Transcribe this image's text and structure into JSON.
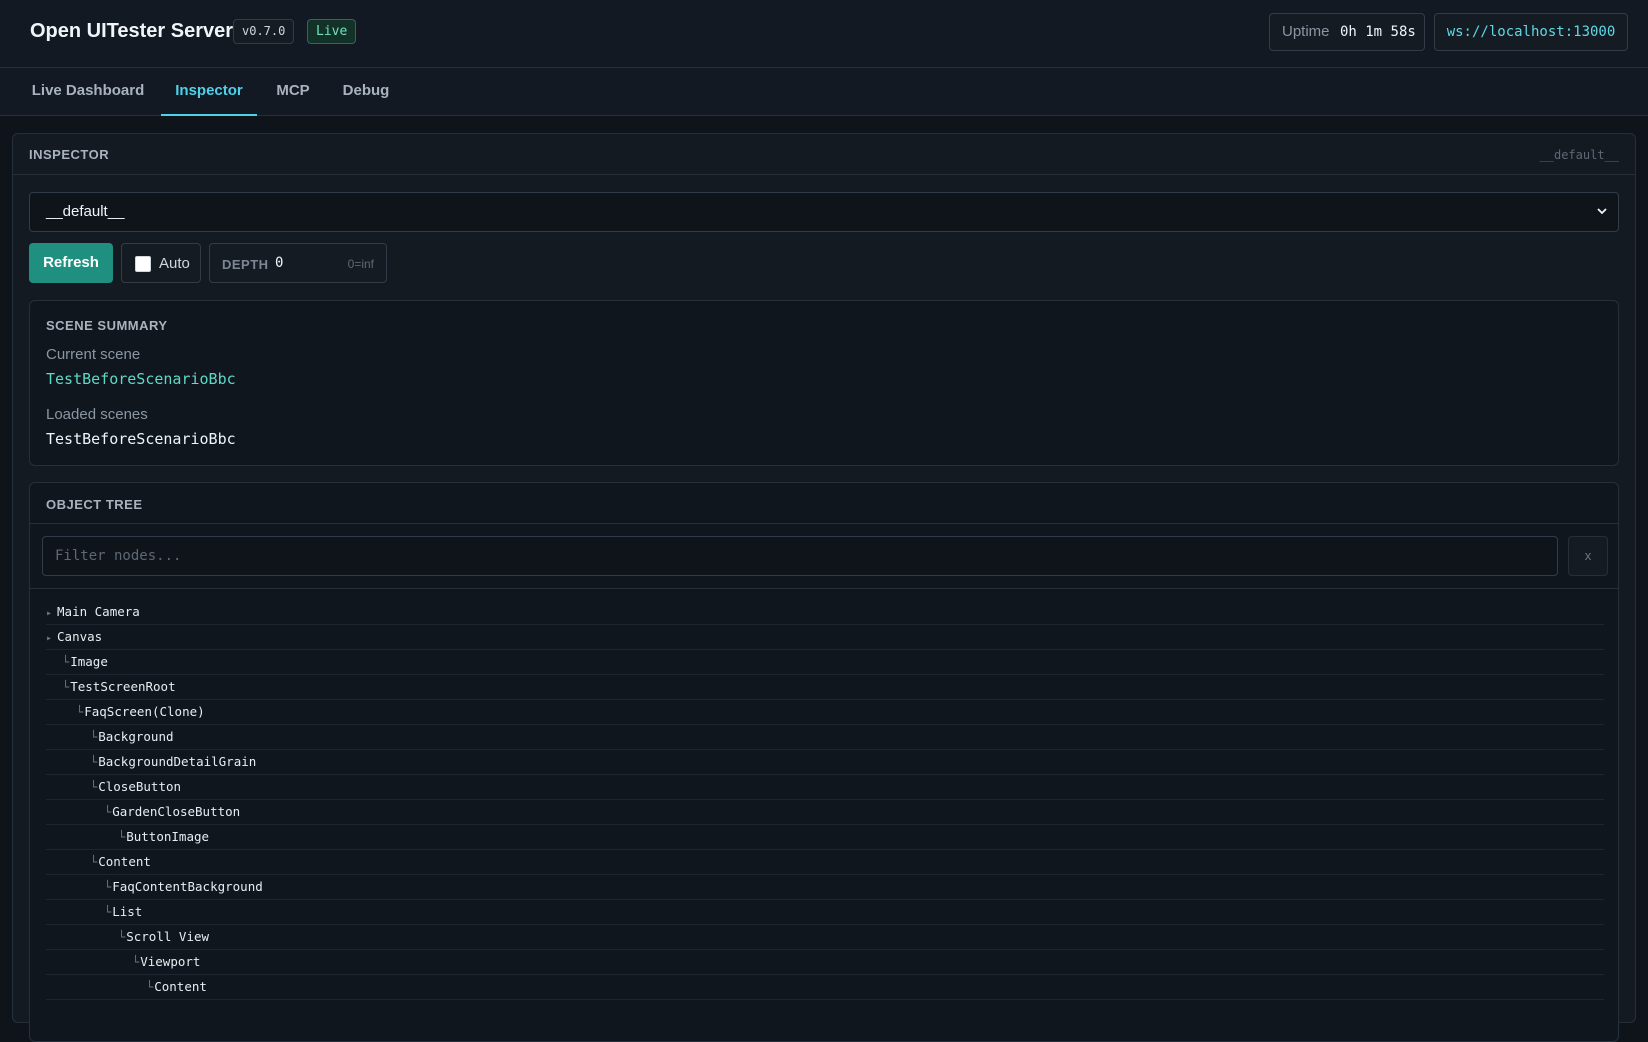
{
  "header": {
    "title": "Open UITester Server",
    "version": "v0.7.0",
    "status": "Live",
    "uptime_label": "Uptime",
    "uptime_value": "0h 1m 58s",
    "ws_url": "ws://localhost:13000"
  },
  "tabs": [
    {
      "label": "Live Dashboard",
      "active": false
    },
    {
      "label": "Inspector",
      "active": true
    },
    {
      "label": "MCP",
      "active": false
    },
    {
      "label": "Debug",
      "active": false
    }
  ],
  "inspector": {
    "title": "INSPECTOR",
    "target": "__default__",
    "selected_target": "__default__",
    "refresh_label": "Refresh",
    "auto_label": "Auto",
    "auto_checked": false,
    "depth_label": "DEPTH",
    "depth_value": "0",
    "depth_hint": "0=inf"
  },
  "scene_summary": {
    "title": "SCENE SUMMARY",
    "current_label": "Current scene",
    "current_value": "TestBeforeScenarioBbc",
    "loaded_label": "Loaded scenes",
    "loaded_value": "TestBeforeScenarioBbc"
  },
  "object_tree": {
    "title": "OBJECT TREE",
    "filter_placeholder": "Filter nodes...",
    "clear_label": "x",
    "nodes": [
      {
        "label": "Main Camera",
        "depth": 0,
        "expandable": true
      },
      {
        "label": "Canvas",
        "depth": 0,
        "expandable": true
      },
      {
        "label": "Image",
        "depth": 1,
        "expandable": false
      },
      {
        "label": "TestScreenRoot",
        "depth": 1,
        "expandable": false
      },
      {
        "label": "FaqScreen(Clone)",
        "depth": 2,
        "expandable": false
      },
      {
        "label": "Background",
        "depth": 3,
        "expandable": false
      },
      {
        "label": "BackgroundDetailGrain",
        "depth": 3,
        "expandable": false
      },
      {
        "label": "CloseButton",
        "depth": 3,
        "expandable": false
      },
      {
        "label": "GardenCloseButton",
        "depth": 4,
        "expandable": false
      },
      {
        "label": "ButtonImage",
        "depth": 5,
        "expandable": false
      },
      {
        "label": "Content",
        "depth": 3,
        "expandable": false
      },
      {
        "label": "FaqContentBackground",
        "depth": 4,
        "expandable": false
      },
      {
        "label": "List",
        "depth": 4,
        "expandable": false
      },
      {
        "label": "Scroll View",
        "depth": 5,
        "expandable": false
      },
      {
        "label": "Viewport",
        "depth": 6,
        "expandable": false
      },
      {
        "label": "Content",
        "depth": 7,
        "expandable": false
      }
    ]
  },
  "colors": {
    "accent": "#4fd1e8",
    "primary_button": "#1f8f7f",
    "live": "#73e0c0",
    "current_scene": "#5fd8c8"
  }
}
